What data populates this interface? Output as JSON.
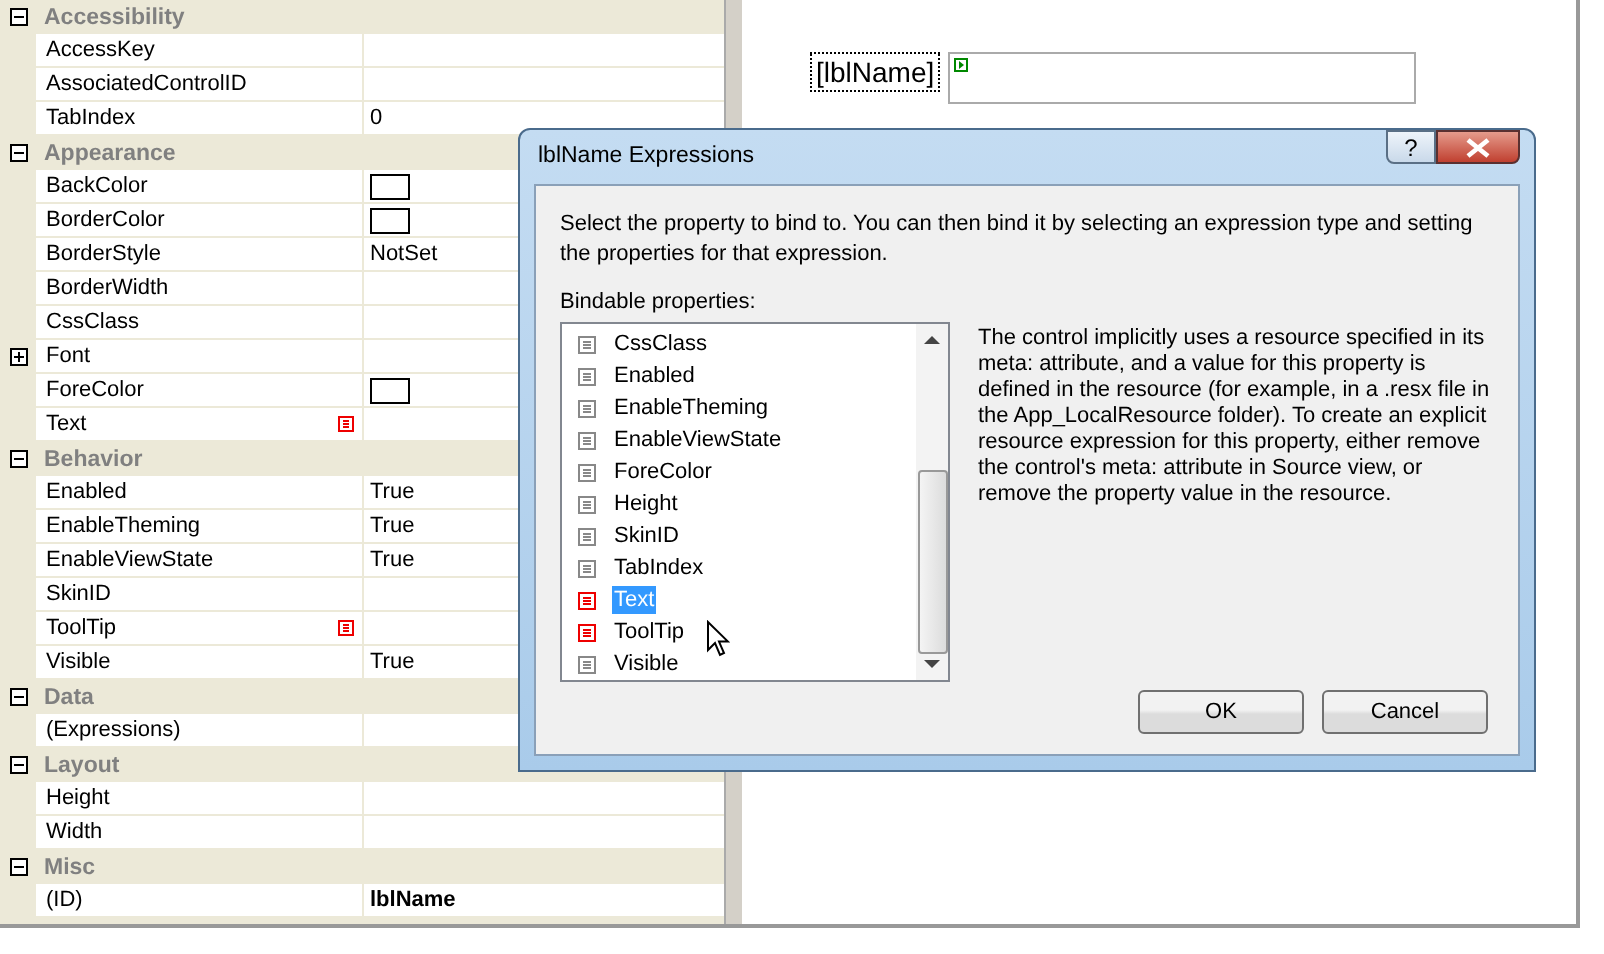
{
  "property_grid": {
    "categories": [
      {
        "name": "Accessibility",
        "expanded": true,
        "items": [
          {
            "name": "AccessKey",
            "kind": "text",
            "value": ""
          },
          {
            "name": "AssociatedControlID",
            "kind": "text",
            "value": ""
          },
          {
            "name": "TabIndex",
            "kind": "text",
            "value": "0"
          }
        ]
      },
      {
        "name": "Appearance",
        "expanded": true,
        "items": [
          {
            "name": "BackColor",
            "kind": "color",
            "value": ""
          },
          {
            "name": "BorderColor",
            "kind": "color",
            "value": ""
          },
          {
            "name": "BorderStyle",
            "kind": "text",
            "value": "NotSet"
          },
          {
            "name": "BorderWidth",
            "kind": "text",
            "value": ""
          },
          {
            "name": "CssClass",
            "kind": "text",
            "value": ""
          },
          {
            "name": "Font",
            "kind": "collapsed-group",
            "value": ""
          },
          {
            "name": "ForeColor",
            "kind": "color",
            "value": ""
          },
          {
            "name": "Text",
            "kind": "resource",
            "value": ""
          }
        ]
      },
      {
        "name": "Behavior",
        "expanded": true,
        "items": [
          {
            "name": "Enabled",
            "kind": "text",
            "value": "True"
          },
          {
            "name": "EnableTheming",
            "kind": "text",
            "value": "True"
          },
          {
            "name": "EnableViewState",
            "kind": "text",
            "value": "True"
          },
          {
            "name": "SkinID",
            "kind": "text",
            "value": ""
          },
          {
            "name": "ToolTip",
            "kind": "resource",
            "value": ""
          },
          {
            "name": "Visible",
            "kind": "text",
            "value": "True"
          }
        ]
      },
      {
        "name": "Data",
        "expanded": true,
        "items": [
          {
            "name": "(Expressions)",
            "kind": "text",
            "value": ""
          }
        ]
      },
      {
        "name": "Layout",
        "expanded": true,
        "items": [
          {
            "name": "Height",
            "kind": "text",
            "value": ""
          },
          {
            "name": "Width",
            "kind": "text",
            "value": ""
          }
        ]
      },
      {
        "name": "Misc",
        "expanded": true,
        "items": [
          {
            "name": "(ID)",
            "kind": "bold",
            "value": "lblName"
          }
        ]
      }
    ]
  },
  "designer": {
    "label_control": "[lblName]"
  },
  "dialog": {
    "title": "lblName Expressions",
    "help_button": "?",
    "instruction": "Select the property to bind to.  You can then bind it by selecting an expression type and setting the properties for that expression.",
    "list_label": "Bindable properties:",
    "properties": [
      {
        "name": "CssClass",
        "kind": "plain",
        "selected": false
      },
      {
        "name": "Enabled",
        "kind": "plain",
        "selected": false
      },
      {
        "name": "EnableTheming",
        "kind": "plain",
        "selected": false
      },
      {
        "name": "EnableViewState",
        "kind": "plain",
        "selected": false
      },
      {
        "name": "ForeColor",
        "kind": "plain",
        "selected": false
      },
      {
        "name": "Height",
        "kind": "plain",
        "selected": false
      },
      {
        "name": "SkinID",
        "kind": "plain",
        "selected": false
      },
      {
        "name": "TabIndex",
        "kind": "plain",
        "selected": false
      },
      {
        "name": "Text",
        "kind": "resource",
        "selected": true
      },
      {
        "name": "ToolTip",
        "kind": "resource",
        "selected": false
      },
      {
        "name": "Visible",
        "kind": "plain",
        "selected": false
      }
    ],
    "description": "The control implicitly uses a resource specified in its meta: attribute, and a value for this property is defined in the resource (for example, in a .resx file in the App_LocalResource folder). To create an explicit resource expression for this property, either remove the control's meta: attribute in Source view, or remove the property value in the resource.",
    "buttons": [
      {
        "label": "OK"
      },
      {
        "label": "Cancel"
      }
    ]
  }
}
